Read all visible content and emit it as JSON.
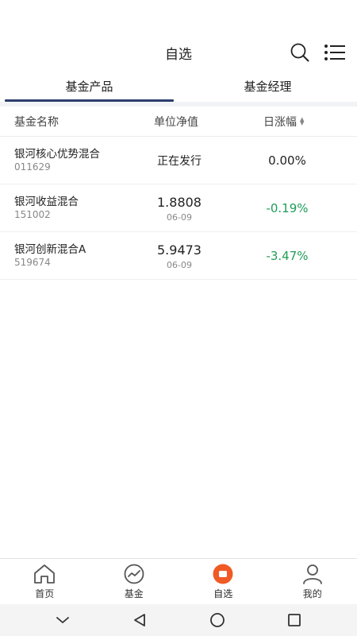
{
  "header": {
    "title": "自选"
  },
  "tabs": [
    {
      "label": "基金产品",
      "active": true
    },
    {
      "label": "基金经理",
      "active": false
    }
  ],
  "columns": {
    "name": "基金名称",
    "nav": "单位净值",
    "change": "日涨幅"
  },
  "funds": [
    {
      "name": "银河核心优势混合",
      "code": "011629",
      "nav": "正在发行",
      "date": "",
      "change": "0.00%",
      "change_color": "#222222"
    },
    {
      "name": "银河收益混合",
      "code": "151002",
      "nav": "1.8808",
      "date": "06-09",
      "change": "-0.19%",
      "change_color": "#1f9d57"
    },
    {
      "name": "银河创新混合A",
      "code": "519674",
      "nav": "5.9473",
      "date": "06-09",
      "change": "-3.47%",
      "change_color": "#1f9d57"
    }
  ],
  "bottom_nav": [
    {
      "label": "首页",
      "icon": "home-icon"
    },
    {
      "label": "基金",
      "icon": "fund-chart-icon"
    },
    {
      "label": "自选",
      "icon": "watchlist-icon",
      "active": true
    },
    {
      "label": "我的",
      "icon": "profile-icon"
    }
  ],
  "colors": {
    "accent": "#f05a24",
    "tab_underline": "#2c3e6b",
    "negative": "#1f9d57"
  }
}
